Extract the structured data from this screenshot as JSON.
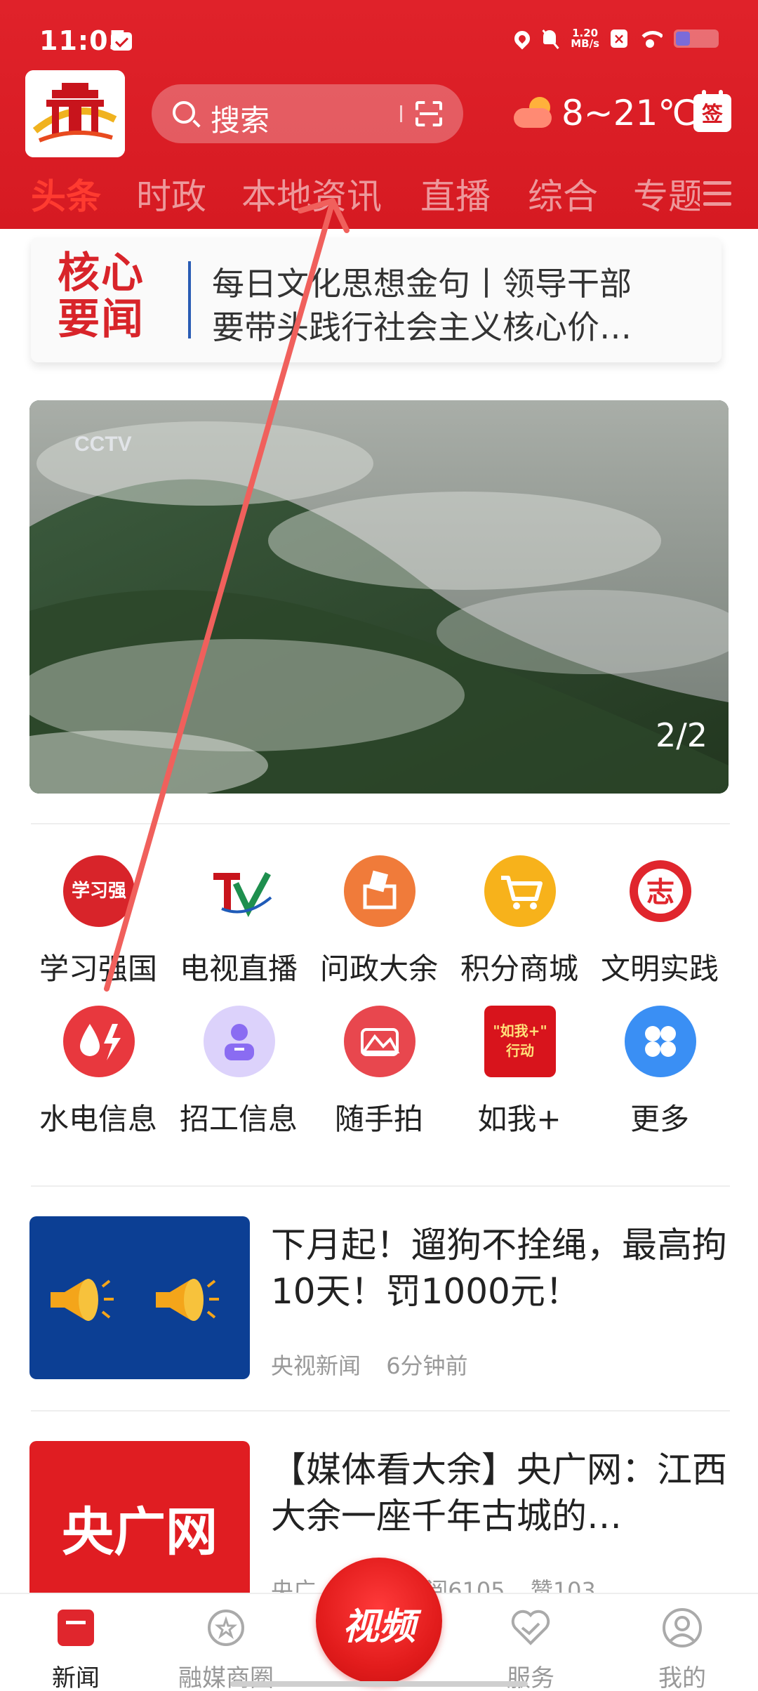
{
  "status_bar": {
    "time": "11:05",
    "net_speed_value": "1.20",
    "net_speed_unit": "MB/s"
  },
  "header": {
    "search_placeholder": "搜索",
    "weather_text": "8~21℃",
    "sign_label": "签"
  },
  "tabs": [
    {
      "label": "头条",
      "active": true
    },
    {
      "label": "时政"
    },
    {
      "label": "本地资讯"
    },
    {
      "label": "直播"
    },
    {
      "label": "综合"
    },
    {
      "label": "专题"
    }
  ],
  "core_news": {
    "badge_line1": "核心",
    "badge_line2": "要闻",
    "text_line1": "每日文化思想金句丨领导干部",
    "text_line2": "要带头践行社会主义核心价…"
  },
  "banner": {
    "counter": "2/2"
  },
  "shortcuts": [
    {
      "label": "学习强国",
      "icon": "xuexi-qiangguo-icon"
    },
    {
      "label": "电视直播",
      "icon": "tv-live-icon"
    },
    {
      "label": "问政大余",
      "icon": "inquiry-icon"
    },
    {
      "label": "积分商城",
      "icon": "shopping-cart-icon"
    },
    {
      "label": "文明实践",
      "icon": "civilization-practice-icon"
    },
    {
      "label": "水电信息",
      "icon": "water-power-icon"
    },
    {
      "label": "招工信息",
      "icon": "recruitment-icon"
    },
    {
      "label": "随手拍",
      "icon": "snapshot-icon"
    },
    {
      "label": "如我+",
      "icon": "ruwo-action-icon"
    },
    {
      "label": "更多",
      "icon": "more-apps-icon"
    }
  ],
  "news": [
    {
      "title": "下月起！遛狗不拴绳，最高拘10天！罚1000元！",
      "source": "央视新闻",
      "time": "6分钟前"
    },
    {
      "title": "【媒体看大余】央广网：江西大余一座千年古城的…",
      "thumb_text": "央广网",
      "source": "央广",
      "reads": "阅6105",
      "likes": "赞103"
    }
  ],
  "bottom_nav": {
    "news": "新闻",
    "mall": "融媒商圈",
    "video": "视频",
    "service": "服务",
    "mine": "我的"
  },
  "colors": {
    "brand_red": "#d61a22",
    "active_tab": "#ff3b30"
  }
}
